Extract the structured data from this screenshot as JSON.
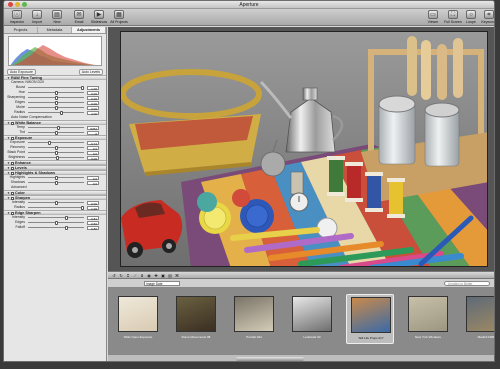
{
  "window": {
    "title": "Aperture",
    "traffic_colors": [
      "#e0443e",
      "#e0b52c",
      "#5fb84a"
    ]
  },
  "toolbar": {
    "left": [
      {
        "label": "Inspector",
        "icon": "inspector-icon",
        "glyph": "ⓘ"
      },
      {
        "label": "Import",
        "icon": "import-icon",
        "glyph": "↓"
      },
      {
        "label": "New",
        "icon": "new-icon",
        "glyph": "▤"
      },
      {
        "label": "Email",
        "icon": "email-icon",
        "glyph": "✉"
      },
      {
        "label": "Slideshow",
        "icon": "slideshow-icon",
        "glyph": "▶"
      },
      {
        "label": "All Projects",
        "icon": "all-projects-icon",
        "glyph": "▦"
      }
    ],
    "right": [
      {
        "label": "Viewer",
        "icon": "viewer-icon",
        "glyph": "▭"
      },
      {
        "label": "Full Screen",
        "icon": "full-screen-icon",
        "glyph": "⛶"
      },
      {
        "label": "Loupe",
        "icon": "loupe-icon",
        "glyph": "○"
      },
      {
        "label": "Keywords",
        "icon": "keywords-icon",
        "glyph": "⌗"
      }
    ]
  },
  "sidebar": {
    "tabs": [
      "Projects",
      "Metadata",
      "Adjustments"
    ],
    "histogram_buttons": [
      "Auto Exposure",
      "Auto Levels"
    ],
    "sections": [
      {
        "title": "RAW Fine Tuning",
        "checkbox": false,
        "rows": [
          {
            "label": "Boost",
            "value": "1.00"
          },
          {
            "label": "Hue",
            "value": "0.00"
          },
          {
            "label": "Sharpening",
            "value": "0.00"
          },
          {
            "label": "Edges",
            "value": "0.00"
          },
          {
            "label": "Moire",
            "value": "0.00"
          },
          {
            "label": "Radius",
            "value": "4.00"
          }
        ],
        "note": "Camera: NIKON D2X",
        "extra": "Auto Noise Compensation"
      },
      {
        "title": "White Balance",
        "checkbox": true,
        "rows": [
          {
            "label": "Temp",
            "value": "5752 K"
          },
          {
            "label": "Tint",
            "value": "0"
          }
        ]
      },
      {
        "title": "Exposure",
        "checkbox": true,
        "rows": [
          {
            "label": "Exposure",
            "value": "-0.74"
          },
          {
            "label": "Recovery",
            "value": "0.0"
          },
          {
            "label": "Black Point",
            "value": "0.0"
          },
          {
            "label": "Brightness",
            "value": "0.06"
          }
        ]
      },
      {
        "title": "Enhance",
        "checkbox": true,
        "rows": []
      },
      {
        "title": "Levels",
        "checkbox": true,
        "rows": []
      },
      {
        "title": "Highlights & Shadows",
        "checkbox": true,
        "rows": [
          {
            "label": "Highlights",
            "value": "0.0"
          },
          {
            "label": "Shadows",
            "value": "0.0"
          }
        ],
        "extra": "Advanced"
      },
      {
        "title": "Color",
        "checkbox": true,
        "rows": []
      },
      {
        "title": "Sharpen",
        "checkbox": true,
        "rows": [
          {
            "label": "Intensity",
            "value": "0.00"
          },
          {
            "label": "Radius",
            "value": "1.00"
          }
        ]
      },
      {
        "title": "Edge Sharpen",
        "checkbox": true,
        "rows": [
          {
            "label": "Intensity",
            "value": "0.81"
          },
          {
            "label": "Edges",
            "value": "0.50"
          },
          {
            "label": "Falloff",
            "value": "0.80"
          }
        ]
      }
    ]
  },
  "browser": {
    "filter": "Image Date",
    "search_placeholder": "Unrated or Better",
    "thumbs": [
      {
        "caption": "Wide Open Exposure"
      },
      {
        "caption": "Rome Monuments 08"
      },
      {
        "caption": "Portrait 044"
      },
      {
        "caption": "Lenticular 03"
      },
      {
        "caption": "Still Life Props 017",
        "selected": true
      },
      {
        "caption": "New York Windows"
      },
      {
        "caption": "Madrid 0486"
      },
      {
        "caption": "Madrid 0487"
      }
    ]
  },
  "accent": "#3d6fd6"
}
